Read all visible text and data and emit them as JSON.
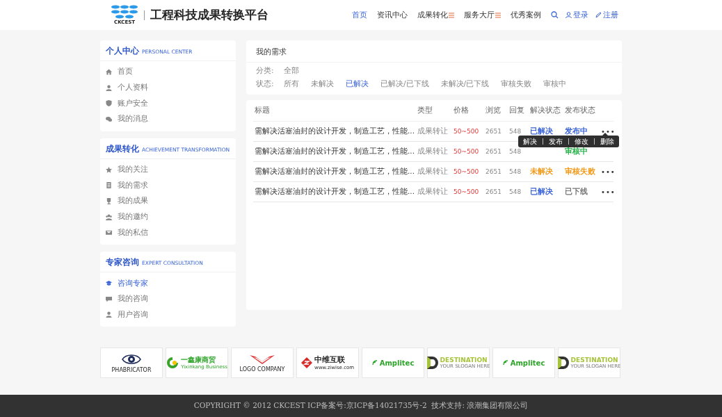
{
  "header": {
    "logo_mark": "CKCEST",
    "site_name": "工程科技成果转换平台",
    "nav": [
      {
        "label": "首页",
        "selected": true,
        "dropdown": false
      },
      {
        "label": "资讯中心",
        "selected": false,
        "dropdown": false
      },
      {
        "label": "成果转化",
        "selected": false,
        "dropdown": true
      },
      {
        "label": "服务大厅",
        "selected": false,
        "dropdown": true
      },
      {
        "label": "优秀案例",
        "selected": false,
        "dropdown": false
      }
    ],
    "login": "登录",
    "register": "注册"
  },
  "sidebar": [
    {
      "title": "个人中心",
      "subtitle": "PERSONAL CENTER",
      "items": [
        {
          "label": "首页",
          "selected": false
        },
        {
          "label": "个人资料",
          "selected": false
        },
        {
          "label": "账户安全",
          "selected": false
        },
        {
          "label": "我的消息",
          "selected": false
        }
      ]
    },
    {
      "title": "成果转化",
      "subtitle": "ACHIEVEMENT TRANSFORMATION",
      "items": [
        {
          "label": "我的关注",
          "selected": false
        },
        {
          "label": "我的需求",
          "selected": false
        },
        {
          "label": "我的成果",
          "selected": false
        },
        {
          "label": "我的邀约",
          "selected": false
        },
        {
          "label": "我的私信",
          "selected": false
        }
      ]
    },
    {
      "title": "专家咨询",
      "subtitle": "EXPERT CONSULTATION",
      "items": [
        {
          "label": "咨询专家",
          "selected": true
        },
        {
          "label": "我的咨询",
          "selected": false
        },
        {
          "label": "用户咨询",
          "selected": false
        }
      ]
    }
  ],
  "filter_panel": {
    "title": "我的需求",
    "category_label": "分类:",
    "category_value": "全部",
    "status_label": "状态:",
    "status_options": [
      {
        "label": "所有",
        "selected": false
      },
      {
        "label": "未解决",
        "selected": false
      },
      {
        "label": "已解决",
        "selected": true
      },
      {
        "label": "已解决/已下线",
        "selected": false
      },
      {
        "label": "未解决/已下线",
        "selected": false
      },
      {
        "label": "审核失败",
        "selected": false
      },
      {
        "label": "审核中",
        "selected": false
      }
    ]
  },
  "table": {
    "columns": [
      "标题",
      "类型",
      "价格",
      "浏览",
      "回复",
      "解决状态",
      "发布状态"
    ],
    "rows": [
      {
        "title": "需解决活塞油封的设计开发，制造工艺，性能...",
        "type": "成果转让",
        "price": "50~500",
        "views": "2651",
        "replies": "548",
        "solve_status": {
          "text": "已解决",
          "color": "#3a64d8"
        },
        "publish_status": {
          "text": "发布中",
          "color": "#3a64d8"
        },
        "more": "•••"
      },
      {
        "title": "需解决活塞油封的设计开发，制造工艺，性能...",
        "type": "成果转让",
        "price": "50~500",
        "views": "2651",
        "replies": "548",
        "publish_status": {
          "text": "审核中",
          "color": "#27b24a"
        }
      },
      {
        "title": "需解决活塞油封的设计开发，制造工艺，性能...",
        "type": "成果转让",
        "price": "50~500",
        "views": "2651",
        "replies": "548",
        "solve_status": {
          "text": "未解决",
          "color": "#f29a1a"
        },
        "publish_status": {
          "text": "审核失败",
          "color": "#f29a1a"
        },
        "more": "•••"
      },
      {
        "title": "需解决活塞油封的设计开发，制造工艺，性能...",
        "type": "成果转让",
        "price": "50~500",
        "views": "2651",
        "replies": "548",
        "solve_status": {
          "text": "已解决",
          "color": "#3a64d8"
        },
        "publish_status": {
          "text": "已下线",
          "color": "#777777"
        },
        "more": "•••"
      }
    ],
    "action_menu": [
      "解决",
      "发布",
      "修改",
      "删除"
    ]
  },
  "partners": [
    {
      "kind": "eye",
      "text": "PHABRICATOR"
    },
    {
      "kind": "leaf",
      "text": "一鑫康商贸",
      "sub": "Yixinkang Business"
    },
    {
      "kind": "wings",
      "text": "LOGO COMPANY"
    },
    {
      "kind": "diamond",
      "text": "中维互联",
      "sub": "www.ziwise.com"
    },
    {
      "kind": "signal",
      "text": "Amplitec"
    },
    {
      "kind": "dletter",
      "text": "DESTINATION",
      "sub": "YOUR SLOGAN HERE"
    },
    {
      "kind": "signal",
      "text": "Amplitec"
    },
    {
      "kind": "dletter",
      "text": "DESTINATION",
      "sub": "YOUR SLOGAN HERE"
    }
  ],
  "footer": "COPYRIGHT © 2012 CKCEST ICP备案号:京ICP备14021735号-2  技术支持: 浪潮集团有限公司"
}
